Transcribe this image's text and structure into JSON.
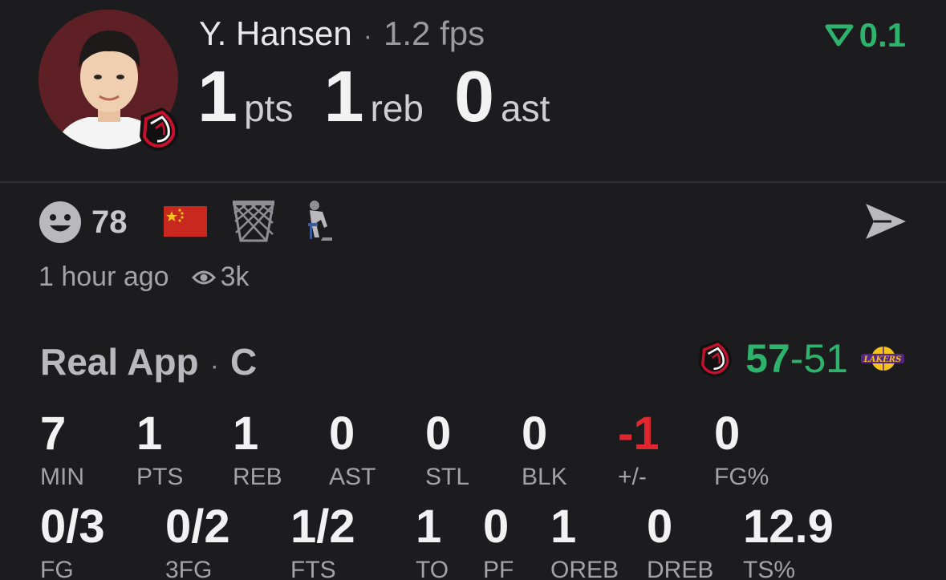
{
  "player": {
    "name": "Y. Hansen",
    "fps": "1.2 fps",
    "rating": "0.1",
    "headline": [
      {
        "value": "1",
        "unit": "pts"
      },
      {
        "value": "1",
        "unit": "reb"
      },
      {
        "value": "0",
        "unit": "ast"
      }
    ]
  },
  "meta": {
    "reactions": "78",
    "time_ago": "1 hour ago",
    "views": "3k",
    "icons": [
      "smile-icon",
      "china-flag-icon",
      "basketball-net-icon",
      "thinking-pose-icon",
      "share-icon"
    ]
  },
  "game": {
    "source": "Real App",
    "position": "C",
    "home_score": "57",
    "away_score": "51",
    "colors": {
      "accent": "#2db36b",
      "negative": "#e0262f",
      "home_team": "#c8102e",
      "away_team": "#552583"
    }
  },
  "stats_row1": [
    {
      "value": "7",
      "label": "MIN"
    },
    {
      "value": "1",
      "label": "PTS"
    },
    {
      "value": "1",
      "label": "REB"
    },
    {
      "value": "0",
      "label": "AST"
    },
    {
      "value": "0",
      "label": "STL"
    },
    {
      "value": "0",
      "label": "BLK"
    },
    {
      "value": "-1",
      "label": "+/-"
    },
    {
      "value": "0",
      "label": "FG%"
    }
  ],
  "stats_row2": [
    {
      "value": "0/3",
      "label": "FG"
    },
    {
      "value": "0/2",
      "label": "3FG"
    },
    {
      "value": "1/2",
      "label": "FTS"
    },
    {
      "value": "1",
      "label": "TO"
    },
    {
      "value": "0",
      "label": "PF"
    },
    {
      "value": "1",
      "label": "OREB"
    },
    {
      "value": "0",
      "label": "DREB"
    },
    {
      "value": "12.9",
      "label": "TS%"
    }
  ]
}
